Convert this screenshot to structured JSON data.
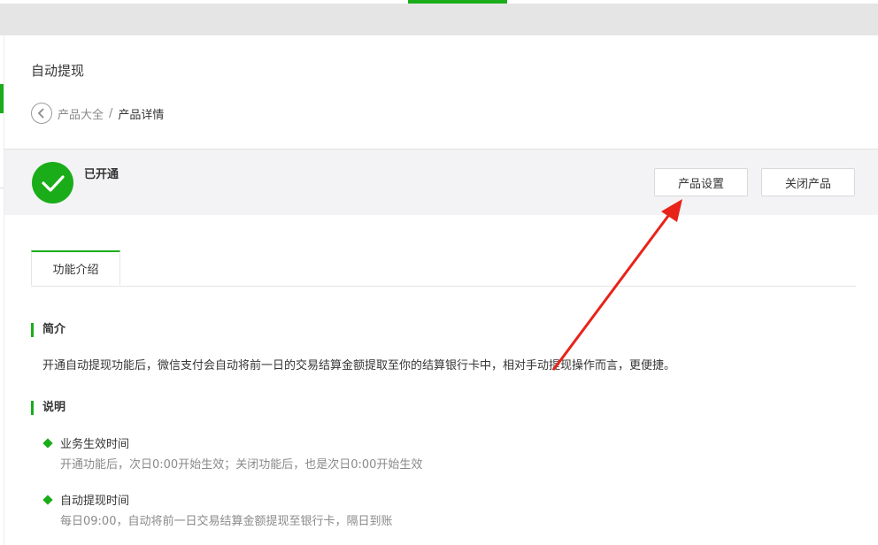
{
  "header": {
    "page_title": "自动提现"
  },
  "breadcrumb": {
    "parent": "产品大全",
    "separator": "/",
    "current": "产品详情"
  },
  "status": {
    "label": "已开通",
    "icon": "check-circle-icon",
    "color": "#1aad19"
  },
  "actions": {
    "settings_label": "产品设置",
    "close_label": "关闭产品"
  },
  "tabs": [
    {
      "label": "功能介绍",
      "active": true
    }
  ],
  "intro": {
    "heading": "简介",
    "text": "开通自动提现功能后，微信支付会自动将前一日的交易结算金额提取至你的结算银行卡中，相对手动提现操作而言，更便捷。"
  },
  "notes": {
    "heading": "说明",
    "items": [
      {
        "title": "业务生效时间",
        "desc": "开通功能后，次日0:00开始生效；关闭功能后，也是次日0:00开始生效"
      },
      {
        "title": "自动提现时间",
        "desc": "每日09:00，自动将前一日交易结算金额提现至银行卡，隔日到账"
      }
    ]
  },
  "colors": {
    "accent": "#1aad19",
    "annotation_arrow": "#e8231a"
  }
}
